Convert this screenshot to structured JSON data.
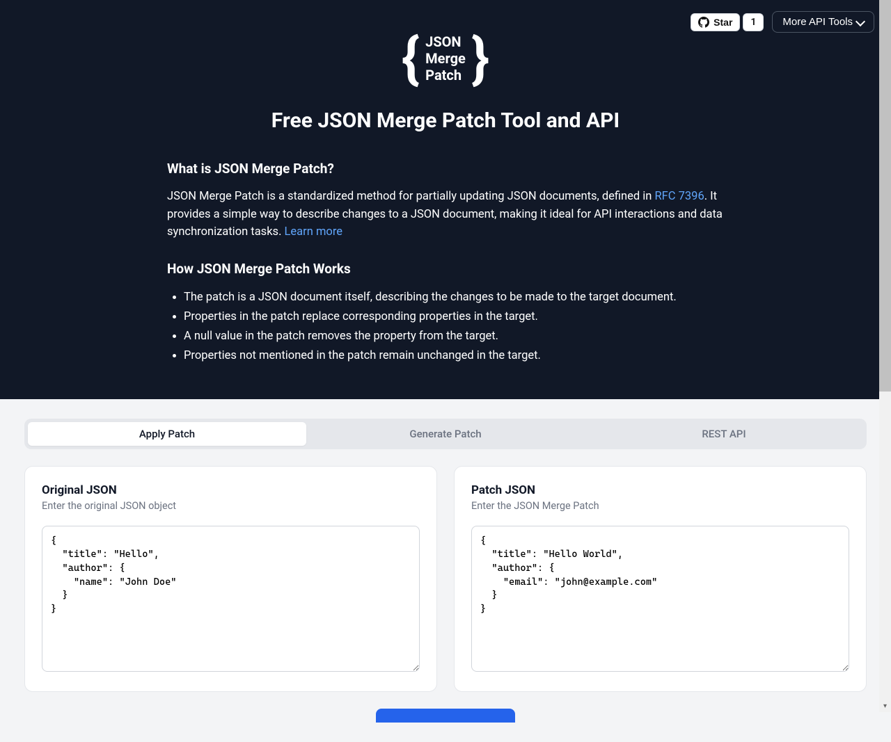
{
  "header": {
    "github": {
      "star_label": "Star",
      "count": "1"
    },
    "more_tools_label": "More API Tools",
    "logo": {
      "line1": "JSON",
      "line2": "Merge",
      "line3": "Patch"
    },
    "title": "Free JSON Merge Patch Tool and API"
  },
  "intro": {
    "heading1": "What is JSON Merge Patch?",
    "p1_before": "JSON Merge Patch is a standardized method for partially updating JSON documents, defined in ",
    "rfc_link": "RFC 7396",
    "p1_after": ". It provides a simple way to describe changes to a JSON document, making it ideal for API interactions and data synchronization tasks. ",
    "learn_more": "Learn more",
    "heading2": "How JSON Merge Patch Works",
    "bullets": [
      "The patch is a JSON document itself, describing the changes to be made to the target document.",
      "Properties in the patch replace corresponding properties in the target.",
      "A null value in the patch removes the property from the target.",
      "Properties not mentioned in the patch remain unchanged in the target."
    ]
  },
  "tabs": {
    "apply": "Apply Patch",
    "generate": "Generate Patch",
    "rest": "REST API"
  },
  "panels": {
    "original": {
      "title": "Original JSON",
      "desc": "Enter the original JSON object",
      "value": "{\n  \"title\": \"Hello\",\n  \"author\": {\n    \"name\": \"John Doe\"\n  }\n}"
    },
    "patch": {
      "title": "Patch JSON",
      "desc": "Enter the JSON Merge Patch",
      "value": "{\n  \"title\": \"Hello World\",\n  \"author\": {\n    \"email\": \"john@example.com\"\n  }\n}"
    }
  }
}
